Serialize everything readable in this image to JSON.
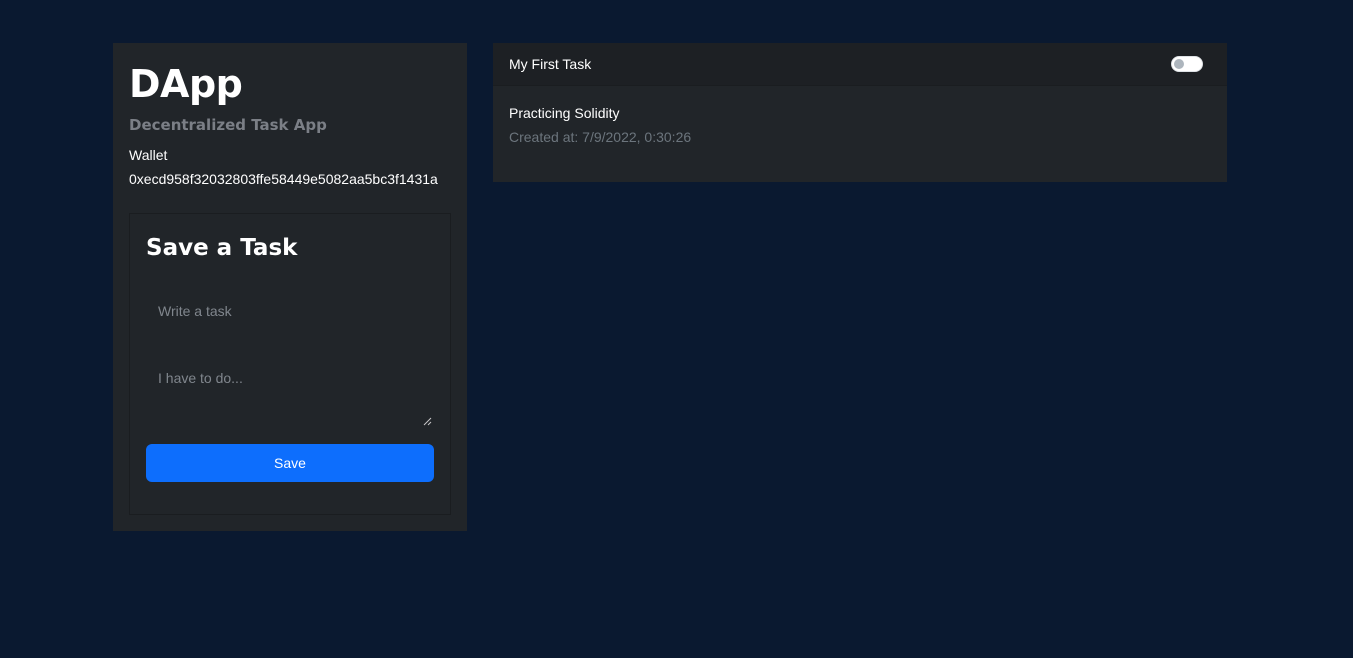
{
  "brand": {
    "title": "DApp",
    "subtitle": "Decentralized Task App"
  },
  "wallet": {
    "label": "Wallet",
    "address": "0xecd958f32032803ffe58449e5082aa5bc3f1431a"
  },
  "save_form": {
    "title": "Save a Task",
    "title_placeholder": "Write a task",
    "description_placeholder": "I have to do...",
    "save_label": "Save"
  },
  "tasks": [
    {
      "title": "My First Task",
      "description": "Practicing Solidity",
      "created_label": "Created at: ",
      "created_at": "7/9/2022, 0:30:26",
      "done": false
    }
  ],
  "colors": {
    "background": "#0a1930",
    "panel": "#212529",
    "accent": "#0d6efd",
    "muted": "#6c757d"
  }
}
